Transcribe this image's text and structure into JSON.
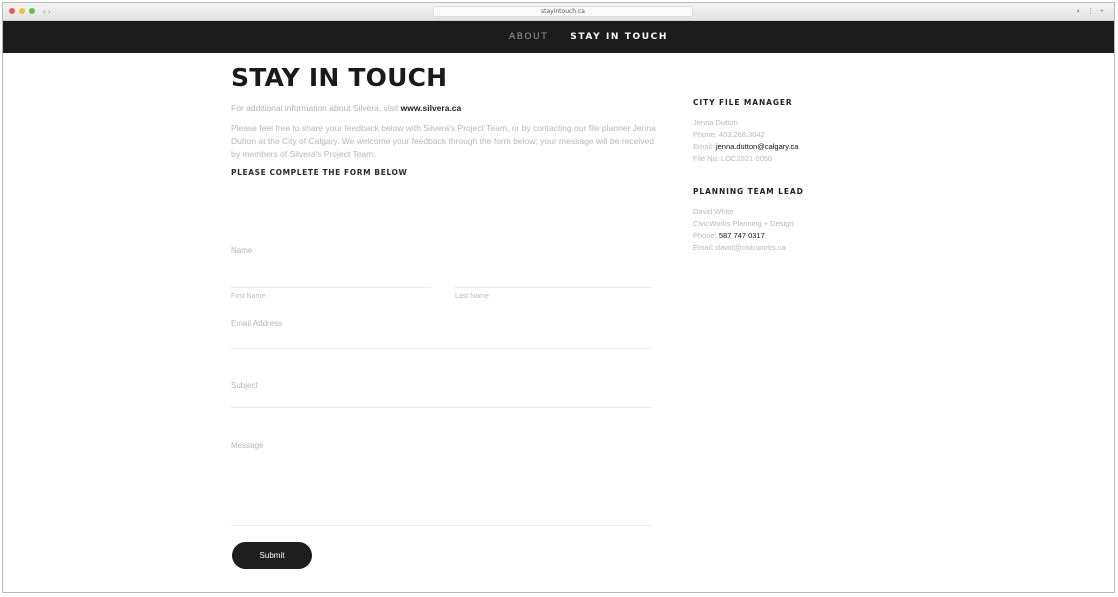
{
  "browser": {
    "url": "stayintouch.ca",
    "right_glyphs": "◐ ⋮ +"
  },
  "nav": {
    "items": [
      "ABOUT",
      "STAY IN TOUCH"
    ]
  },
  "main": {
    "title": "STAY IN TOUCH",
    "intro_text": "For additional information about Silvera, visit",
    "intro_link": "www.silvera.ca",
    "welcome_text": "Please feel free to share your feedback below with Silvera's Project Team, or by contacting our file planner Jenna Dutton at the City of Calgary. We welcome your feedback through the form below; your message will be received by members of Silvera's Project Team.",
    "form_heading": "PLEASE COMPLETE THE FORM BELOW"
  },
  "form": {
    "name_label": "Name",
    "first_name_label": "First Name",
    "last_name_label": "Last Name",
    "email_label": "Email Address",
    "subject_label": "Subject",
    "message_label": "Message",
    "submit_label": "Submit"
  },
  "sidebar": {
    "file_manager": {
      "heading": "CITY FILE MANAGER",
      "name": "Jenna Dutton",
      "phone": "Phone: 403.268.3042",
      "email_prefix": "Email:",
      "email": "jenna.dutton@calgary.ca",
      "file_no": "File No: LOC2021-0050"
    },
    "planning_lead": {
      "heading": "PLANNING TEAM LEAD",
      "name": "David White",
      "company": "CivicWorks Planning + Design",
      "phone_prefix": "Phone:",
      "phone": "587 747 0317",
      "email": "Email: david@civicworks.ca"
    }
  }
}
